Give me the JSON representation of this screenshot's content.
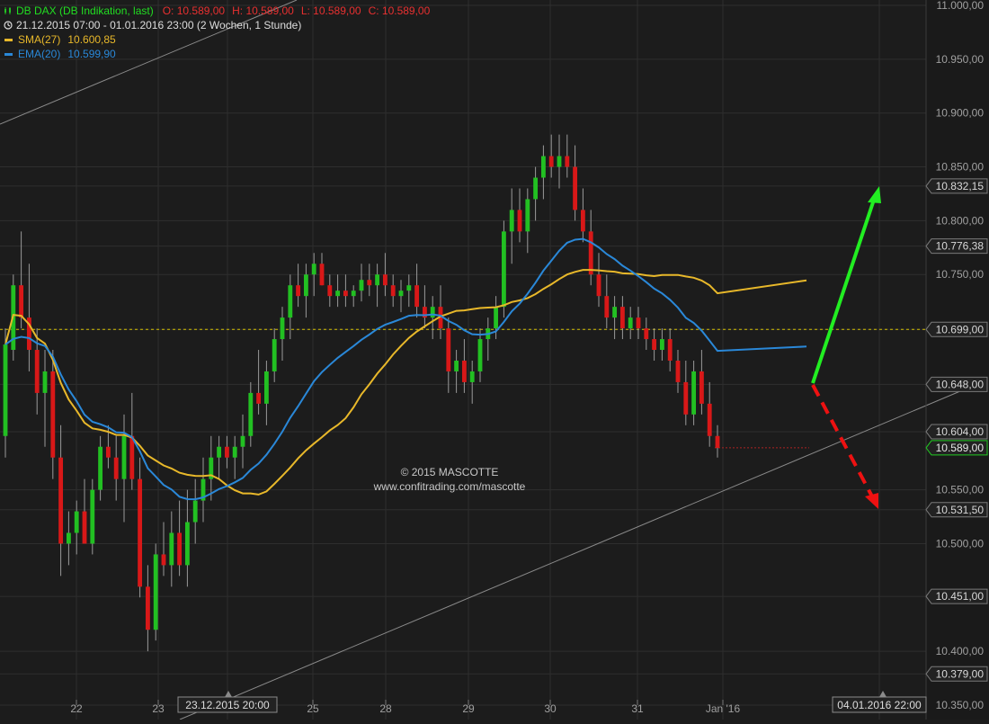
{
  "chart_data": {
    "type": "candlestick",
    "title": "DB DAX (DB Indikation, last)",
    "ohlc": {
      "open": "O: 10.589,00",
      "high": "H: 10.589,00",
      "low": "L: 10.589,00",
      "close": "C: 10.589,00"
    },
    "period": "21.12.2015 07:00 - 01.01.2016 23:00 (2 Wochen, 1 Stunde)",
    "indicators": [
      {
        "name": "SMA(27)",
        "value": "10.600,85",
        "color": "#e8b82a"
      },
      {
        "name": "EMA(20)",
        "value": "10.599,90",
        "color": "#2a88d8"
      }
    ],
    "ylim": [
      10350,
      11000
    ],
    "y_ticks": [
      {
        "value": 11000,
        "label": "11.000,00"
      },
      {
        "value": 10950,
        "label": "10.950,00"
      },
      {
        "value": 10900,
        "label": "10.900,00"
      },
      {
        "value": 10850,
        "label": "10.850,00"
      },
      {
        "value": 10800,
        "label": "10.800,00"
      },
      {
        "value": 10750,
        "label": "10.750,00"
      },
      {
        "value": 10550,
        "label": "10.550,00"
      },
      {
        "value": 10500,
        "label": "10.500,00"
      },
      {
        "value": 10400,
        "label": "10.400,00"
      },
      {
        "value": 10350,
        "label": "10.350,00"
      }
    ],
    "price_labels": [
      {
        "value": 10832.15,
        "label": "10.832,15"
      },
      {
        "value": 10776.38,
        "label": "10.776,38"
      },
      {
        "value": 10699.0,
        "label": "10.699,00"
      },
      {
        "value": 10648.0,
        "label": "10.648,00"
      },
      {
        "value": 10604.0,
        "label": "10.604,00"
      },
      {
        "value": 10531.5,
        "label": "10.531,50"
      },
      {
        "value": 10451.0,
        "label": "10.451,00"
      },
      {
        "value": 10379.0,
        "label": "10.379,00"
      }
    ],
    "last_price": {
      "value": 10589.0,
      "label": "10.589,00"
    },
    "resistance_line": 10699.0,
    "x_ticks": [
      "22",
      "23",
      "25",
      "28",
      "29",
      "30",
      "31",
      "Jan '16"
    ],
    "x_markers": [
      "23.12.2015 20:00",
      "04.01.2016 22:00"
    ],
    "candles": [
      [
        10600,
        10700,
        10580,
        10685
      ],
      [
        10680,
        10750,
        10670,
        10740
      ],
      [
        10740,
        10790,
        10700,
        10710
      ],
      [
        10710,
        10760,
        10660,
        10680
      ],
      [
        10680,
        10700,
        10620,
        10640
      ],
      [
        10640,
        10680,
        10590,
        10660
      ],
      [
        10660,
        10680,
        10560,
        10580
      ],
      [
        10580,
        10610,
        10470,
        10500
      ],
      [
        10500,
        10530,
        10480,
        10510
      ],
      [
        10510,
        10540,
        10490,
        10530
      ],
      [
        10530,
        10560,
        10500,
        10500
      ],
      [
        10500,
        10560,
        10490,
        10550
      ],
      [
        10550,
        10600,
        10540,
        10590
      ],
      [
        10590,
        10610,
        10570,
        10580
      ],
      [
        10580,
        10600,
        10540,
        10560
      ],
      [
        10560,
        10620,
        10520,
        10600
      ],
      [
        10600,
        10640,
        10550,
        10560
      ],
      [
        10560,
        10580,
        10450,
        10460
      ],
      [
        10460,
        10480,
        10400,
        10420
      ],
      [
        10420,
        10500,
        10410,
        10490
      ],
      [
        10490,
        10520,
        10470,
        10480
      ],
      [
        10480,
        10530,
        10460,
        10510
      ],
      [
        10510,
        10540,
        10470,
        10480
      ],
      [
        10480,
        10550,
        10460,
        10520
      ],
      [
        10520,
        10560,
        10500,
        10540
      ],
      [
        10540,
        10580,
        10520,
        10560
      ],
      [
        10560,
        10600,
        10540,
        10580
      ],
      [
        10580,
        10600,
        10560,
        10590
      ],
      [
        10590,
        10600,
        10570,
        10580
      ],
      [
        10580,
        10600,
        10560,
        10590
      ],
      [
        10590,
        10620,
        10570,
        10600
      ],
      [
        10600,
        10650,
        10590,
        10640
      ],
      [
        10640,
        10680,
        10620,
        10630
      ],
      [
        10630,
        10670,
        10610,
        10660
      ],
      [
        10660,
        10700,
        10650,
        10690
      ],
      [
        10690,
        10720,
        10670,
        10710
      ],
      [
        10710,
        10750,
        10690,
        10740
      ],
      [
        10740,
        10760,
        10720,
        10730
      ],
      [
        10730,
        10760,
        10710,
        10750
      ],
      [
        10750,
        10770,
        10730,
        10760
      ],
      [
        10760,
        10770,
        10740,
        10740
      ],
      [
        10740,
        10750,
        10720,
        10730
      ],
      [
        10730,
        10750,
        10720,
        10735
      ],
      [
        10735,
        10750,
        10720,
        10730
      ],
      [
        10730,
        10740,
        10720,
        10735
      ],
      [
        10735,
        10760,
        10725,
        10745
      ],
      [
        10745,
        10760,
        10730,
        10740
      ],
      [
        10740,
        10760,
        10720,
        10750
      ],
      [
        10750,
        10770,
        10730,
        10740
      ],
      [
        10740,
        10750,
        10720,
        10730
      ],
      [
        10730,
        10745,
        10715,
        10735
      ],
      [
        10735,
        10750,
        10720,
        10740
      ],
      [
        10740,
        10760,
        10710,
        10720
      ],
      [
        10720,
        10740,
        10700,
        10710
      ],
      [
        10710,
        10730,
        10690,
        10720
      ],
      [
        10720,
        10740,
        10690,
        10700
      ],
      [
        10700,
        10710,
        10640,
        10660
      ],
      [
        10660,
        10680,
        10640,
        10670
      ],
      [
        10670,
        10690,
        10640,
        10650
      ],
      [
        10650,
        10670,
        10630,
        10660
      ],
      [
        10660,
        10700,
        10650,
        10690
      ],
      [
        10690,
        10710,
        10670,
        10700
      ],
      [
        10700,
        10730,
        10690,
        10720
      ],
      [
        10720,
        10800,
        10710,
        10790
      ],
      [
        10790,
        10830,
        10760,
        10810
      ],
      [
        10810,
        10830,
        10780,
        10790
      ],
      [
        10790,
        10830,
        10770,
        10820
      ],
      [
        10820,
        10850,
        10800,
        10840
      ],
      [
        10840,
        10870,
        10820,
        10860
      ],
      [
        10860,
        10880,
        10840,
        10850
      ],
      [
        10850,
        10880,
        10830,
        10860
      ],
      [
        10860,
        10880,
        10840,
        10850
      ],
      [
        10850,
        10870,
        10800,
        10810
      ],
      [
        10810,
        10830,
        10780,
        10790
      ],
      [
        10790,
        10810,
        10740,
        10750
      ],
      [
        10750,
        10770,
        10720,
        10730
      ],
      [
        10730,
        10750,
        10700,
        10710
      ],
      [
        10710,
        10730,
        10690,
        10720
      ],
      [
        10720,
        10730,
        10690,
        10700
      ],
      [
        10700,
        10720,
        10690,
        10710
      ],
      [
        10710,
        10720,
        10690,
        10700
      ],
      [
        10700,
        10710,
        10680,
        10690
      ],
      [
        10690,
        10700,
        10670,
        10680
      ],
      [
        10680,
        10700,
        10670,
        10690
      ],
      [
        10690,
        10700,
        10660,
        10670
      ],
      [
        10670,
        10680,
        10640,
        10650
      ],
      [
        10650,
        10670,
        10610,
        10620
      ],
      [
        10620,
        10670,
        10610,
        10660
      ],
      [
        10660,
        10680,
        10620,
        10630
      ],
      [
        10630,
        10650,
        10590,
        10600
      ],
      [
        10600,
        10610,
        10580,
        10589
      ]
    ]
  },
  "watermark": {
    "line1": "© 2015 MASCOTTE",
    "line2": "www.confitrading.com/mascotte"
  },
  "colors": {
    "background": "#1c1c1c",
    "up": "#22c022",
    "down": "#d81818",
    "arrow_up": "#22ee22",
    "arrow_down": "#ee1111",
    "resistance": "#d4c000",
    "grid": "#2e2e2e"
  }
}
